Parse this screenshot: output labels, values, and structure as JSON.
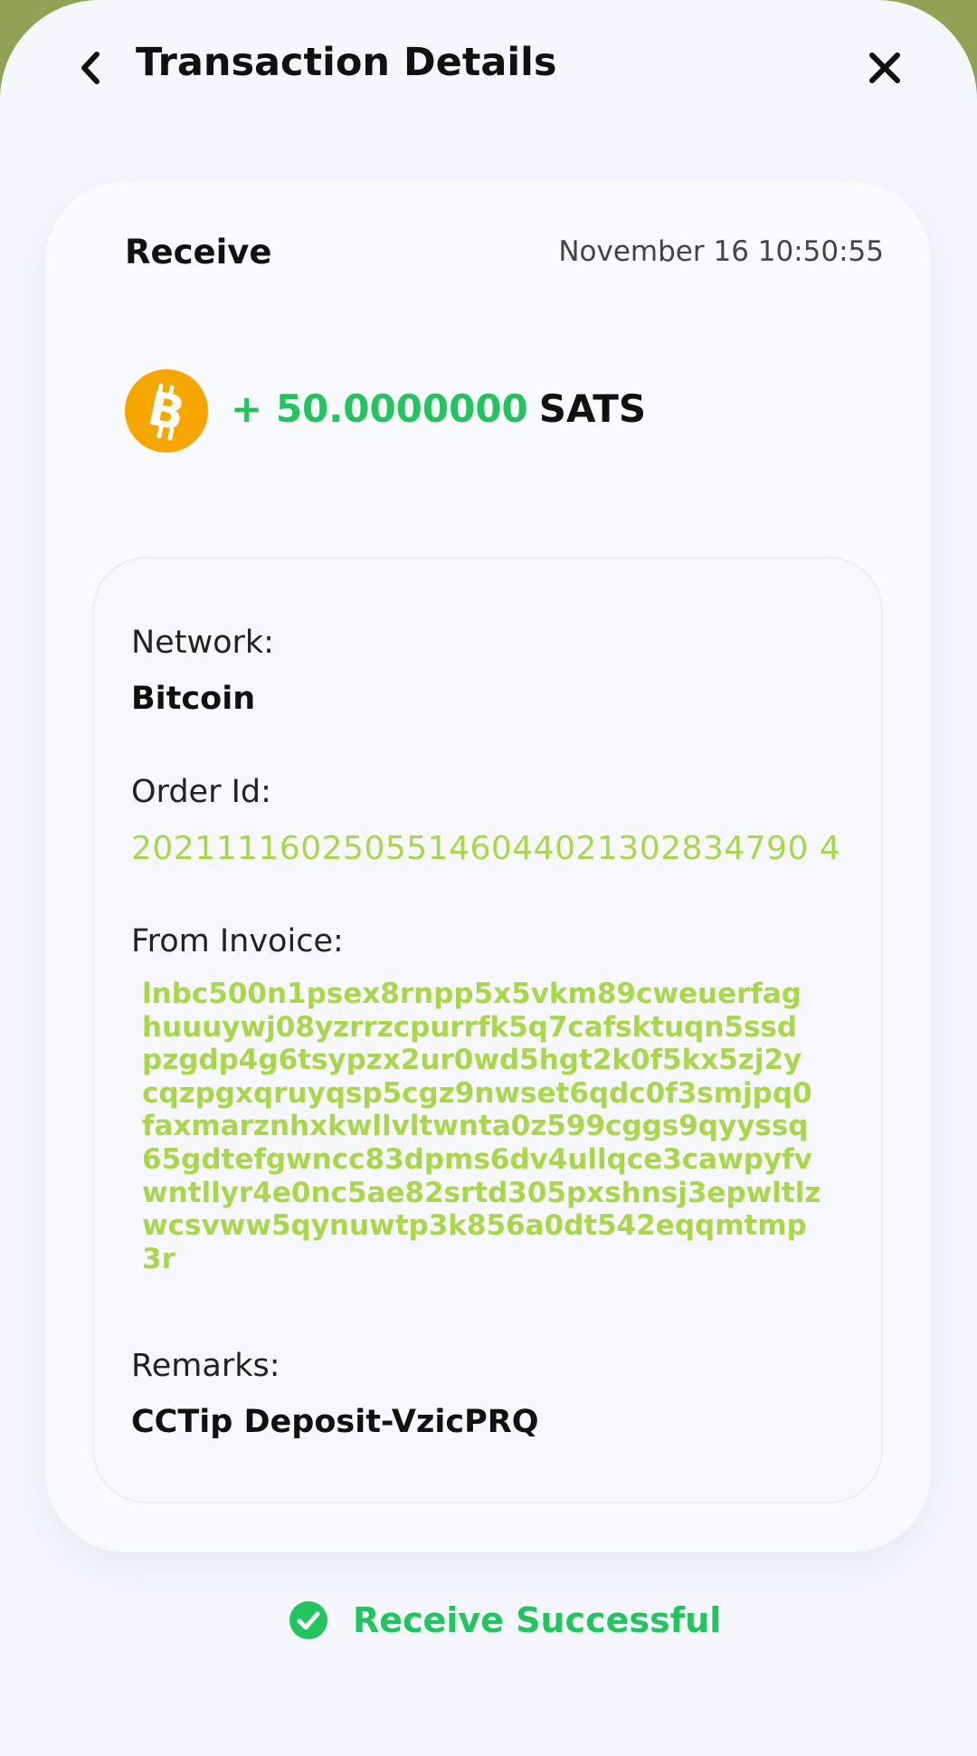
{
  "header": {
    "title": "Transaction Details",
    "back_icon": "chevron-left-icon",
    "close_icon": "close-icon"
  },
  "transaction": {
    "type": "Receive",
    "date": "November 16 10:50:55",
    "coin_icon": "bitcoin-icon",
    "amount": "+ 50.0000000",
    "unit": "SATS"
  },
  "details": {
    "network_label": "Network:",
    "network_value": "Bitcoin",
    "order_label": "Order Id:",
    "order_value": "20211116025055146044021302834790 4",
    "invoice_label": "From Invoice:",
    "invoice_lines": [
      "lnbc500n1psex8rnpp5x5vkm89cweuerfag",
      "huuuywj08yzrrzcpurrfk5q7cafsktuqn5ssd",
      "pzgdp4g6tsypzx2ur0wd5hgt2k0f5kx5zj2y",
      "cqzpgxqruyqsp5cgz9nwset6qdc0f3smjpq0",
      "faxmarznhxkwllvltwnta0z599cggs9qyyssq",
      "65gdtefgwncc83dpms6dv4ullqce3cawpyfv",
      "wntllyr4e0nc5ae82srtd305pxshnsj3epwltlz",
      "wcsvww5qynuwtp3k856a0dt542eqqmtmp",
      "3r"
    ],
    "remarks_label": "Remarks:",
    "remarks_value": "CCTip Deposit-VzicPRQ"
  },
  "status": {
    "icon": "check-circle-icon",
    "text": "Receive Successful"
  },
  "colors": {
    "accent_green": "#22c45e",
    "light_green": "#a8d84a",
    "bitcoin_orange": "#f7a600",
    "background": "#f6f7fd"
  }
}
